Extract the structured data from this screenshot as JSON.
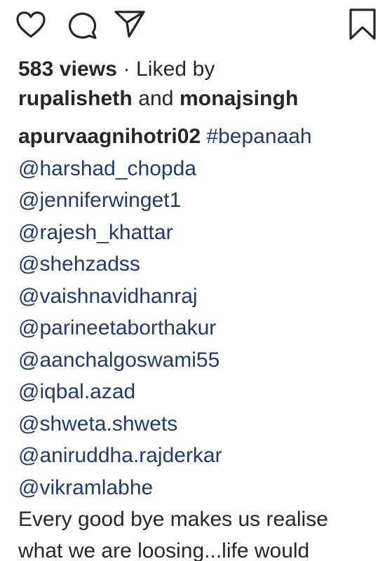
{
  "actions": {
    "like_icon": "heart-icon",
    "comment_icon": "comment-bubble-icon",
    "share_icon": "paper-plane-icon",
    "save_icon": "bookmark-icon"
  },
  "meta": {
    "views": "583 views",
    "separator": " · ",
    "liked_by_label": "Liked by",
    "liker_one": "rupalisheth",
    "and_word": "and",
    "liker_two": "monajsingh"
  },
  "caption": {
    "author": "apurvaagnihotri02",
    "hashtag": "#bepanaah",
    "mentions": [
      "@harshad_chopda",
      "@jenniferwinget1",
      "@rajesh_khattar",
      "@shehzadss",
      "@vaishnavidhanraj",
      "@parineetaborthakur",
      "@aanchalgoswami55",
      "@iqbal.azad",
      "@shweta.shwets",
      "@aniruddha.rajderkar",
      "@vikramlabhe"
    ],
    "text": "Every good bye makes us realise what we are loosing...life would"
  },
  "colors": {
    "text": "#262626",
    "link": "#1f3a6b",
    "background": "#ffffff"
  }
}
